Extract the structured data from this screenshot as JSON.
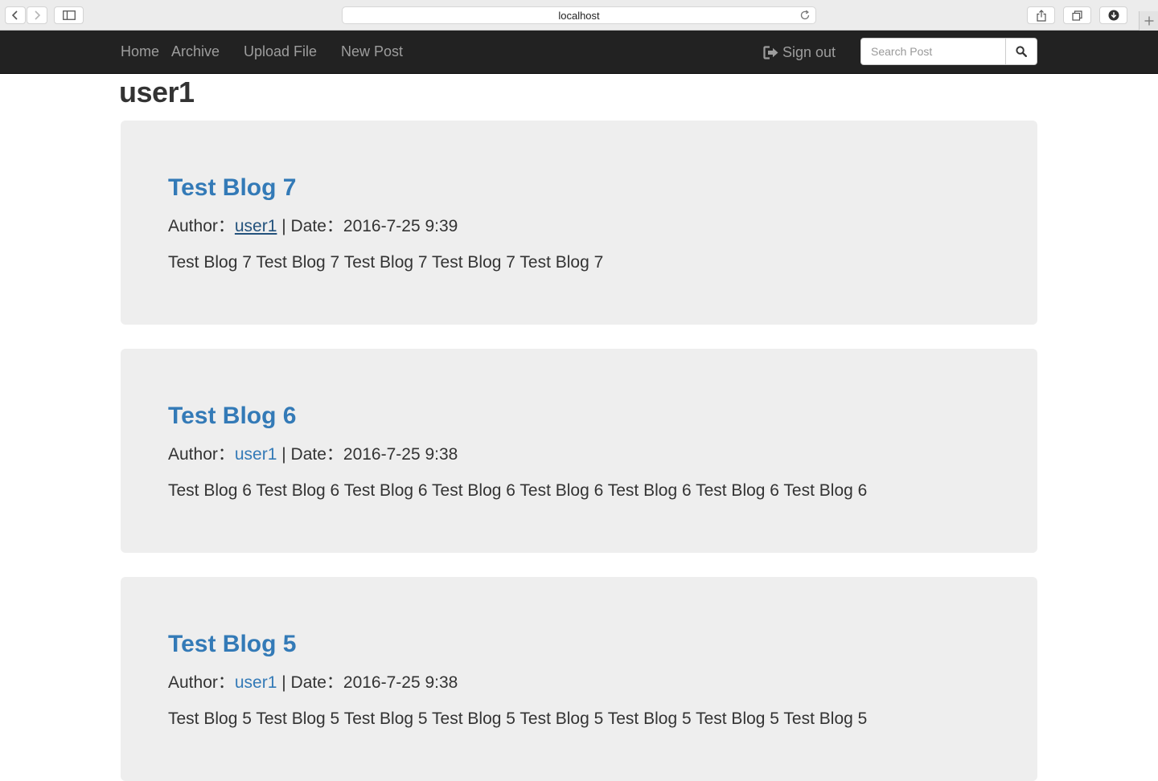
{
  "browser": {
    "url": "localhost"
  },
  "navbar": {
    "links": [
      {
        "label": "Home"
      },
      {
        "label": "Archive"
      },
      {
        "label": "Upload File"
      },
      {
        "label": "New Post"
      }
    ],
    "signout_label": "Sign out",
    "search_placeholder": "Search Post",
    "search_icon": "search-icon",
    "signout_icon": "log-out-icon"
  },
  "page": {
    "title": "user1"
  },
  "posts": [
    {
      "title": "Test Blog 7",
      "author_label": "Author：",
      "author": "user1",
      "separator": " | ",
      "date_label": "Date：",
      "date": "2016-7-25 9:39",
      "body": "Test Blog 7 Test Blog 7 Test Blog 7 Test Blog 7 Test Blog 7"
    },
    {
      "title": "Test Blog 6",
      "author_label": "Author：",
      "author": "user1",
      "separator": " | ",
      "date_label": "Date：",
      "date": "2016-7-25 9:38",
      "body": "Test Blog 6 Test Blog 6 Test Blog 6 Test Blog 6 Test Blog 6 Test Blog 6 Test Blog 6 Test Blog 6"
    },
    {
      "title": "Test Blog 5",
      "author_label": "Author：",
      "author": "user1",
      "separator": " | ",
      "date_label": "Date：",
      "date": "2016-7-25 9:38",
      "body": "Test Blog 5 Test Blog 5 Test Blog 5 Test Blog 5 Test Blog 5 Test Blog 5 Test Blog 5 Test Blog 5"
    }
  ],
  "colors": {
    "navbar_bg": "#222222",
    "nav_text": "#9d9d9d",
    "link": "#337ab7",
    "link_hover": "#23527c",
    "panel_bg": "#eeeeee"
  }
}
